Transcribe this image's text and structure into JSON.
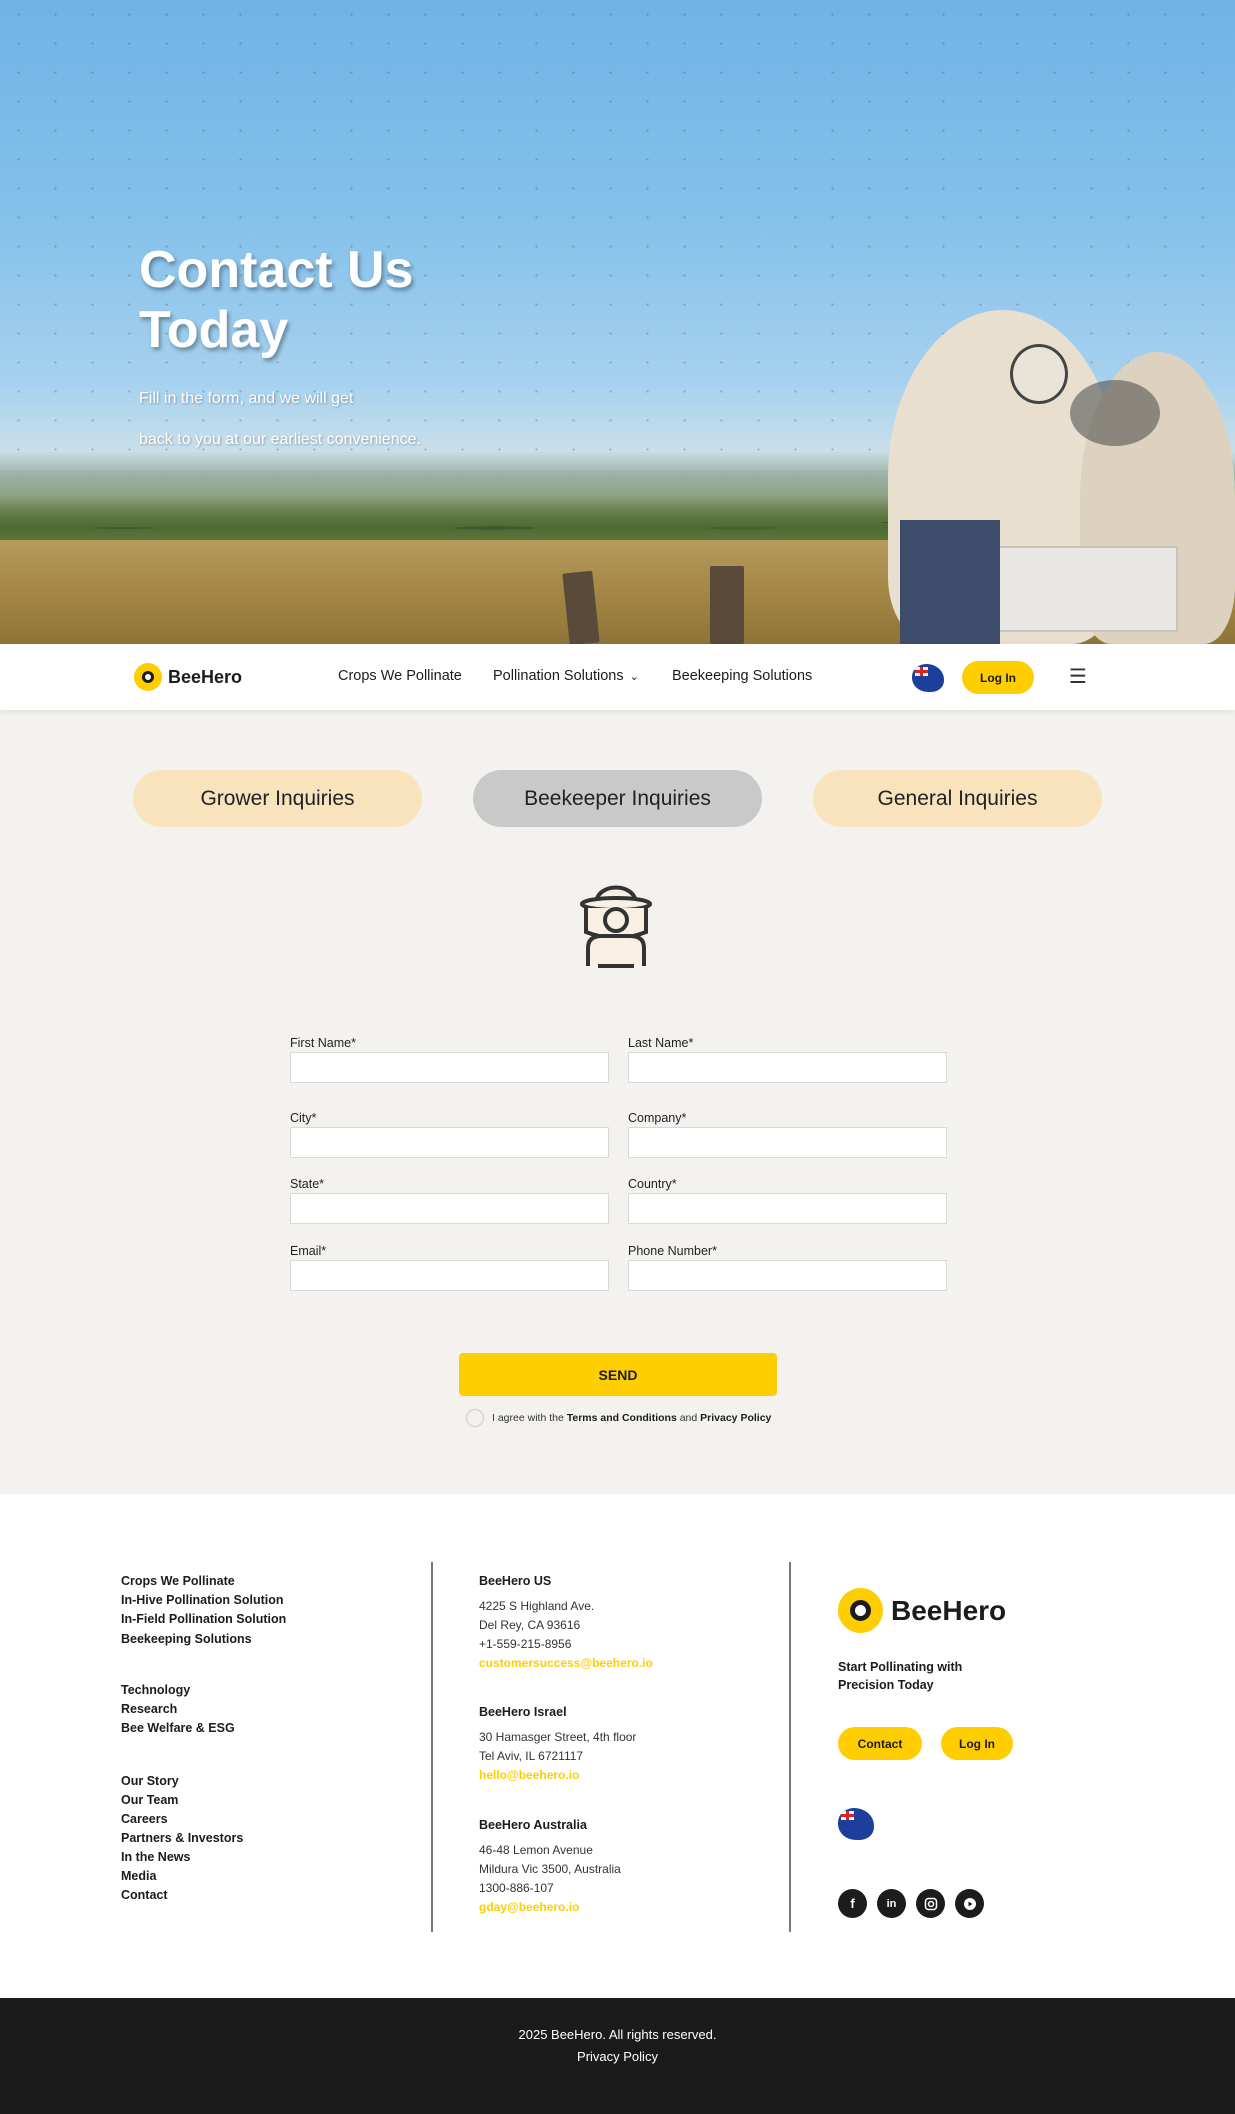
{
  "hero": {
    "title": "Contact Us Today",
    "subtitle_line1": "Fill in the form, and we will get",
    "subtitle_line2": "back to you at our earliest convenience."
  },
  "nav": {
    "logo": "BeeHero",
    "links": [
      "Crops We Pollinate",
      "Pollination Solutions",
      "Beekeeping Solutions"
    ],
    "login_label": "Log In",
    "region": "australia-flag-icon"
  },
  "tabs": [
    {
      "label": "Grower Inquiries",
      "active": false
    },
    {
      "label": "Beekeeper Inquiries",
      "active": true
    },
    {
      "label": "General Inquiries",
      "active": false
    }
  ],
  "form": {
    "fields": [
      {
        "label": "First Name*",
        "value": ""
      },
      {
        "label": "Last Name*",
        "value": ""
      },
      {
        "label": "City*",
        "value": ""
      },
      {
        "label": "Company*",
        "value": ""
      },
      {
        "label": "State*",
        "value": ""
      },
      {
        "label": "Country*",
        "value": ""
      },
      {
        "label": "Email*",
        "value": ""
      },
      {
        "label": "Phone Number*",
        "value": ""
      }
    ],
    "send_label": "SEND",
    "agree_prefix": "I agree with the",
    "terms_label": "Terms and Conditions",
    "and_text": "and",
    "privacy_label": "Privacy Policy"
  },
  "footer": {
    "links_group1": [
      "Crops We Pollinate",
      "In-Hive Pollination Solution",
      "In-Field Pollination Solution",
      "Beekeeping Solutions"
    ],
    "links_group2": [
      "Technology",
      "Research",
      "Bee Welfare & ESG"
    ],
    "links_group3": [
      "Our Story",
      "Our Team",
      "Careers",
      "Partners & Investors",
      "In the News",
      "Media",
      "Contact"
    ],
    "offices": [
      {
        "name": "BeeHero US",
        "lines": [
          "4225 S Highland Ave.",
          "Del Rey, CA 93616",
          "+1-559-215-8956"
        ],
        "email": "customersuccess@beehero.io"
      },
      {
        "name": "BeeHero Israel",
        "lines": [
          "30 Hamasger Street, 4th floor",
          "Tel Aviv, IL 6721117"
        ],
        "email": "hello@beehero.io"
      },
      {
        "name": "BeeHero Australia",
        "lines": [
          "46-48 Lemon Avenue",
          "Mildura Vic 3500, Australia",
          "1300-886-107"
        ],
        "email": "gday@beehero.io"
      }
    ],
    "logo": "BeeHero",
    "tagline": "Start Pollinating with Precision Today",
    "contact_label": "Contact",
    "login_label": "Log In",
    "social": [
      "facebook-icon",
      "linkedin-icon",
      "instagram-icon",
      "youtube-icon"
    ]
  },
  "bottom": {
    "copyright": "2025 BeeHero. All rights reserved.",
    "privacy": "Privacy Policy"
  },
  "colors": {
    "accent": "#ffce00",
    "tab_inactive": "#f9e3bd",
    "tab_active": "#c9c9c9",
    "footer_bar": "#1b1b1b"
  }
}
